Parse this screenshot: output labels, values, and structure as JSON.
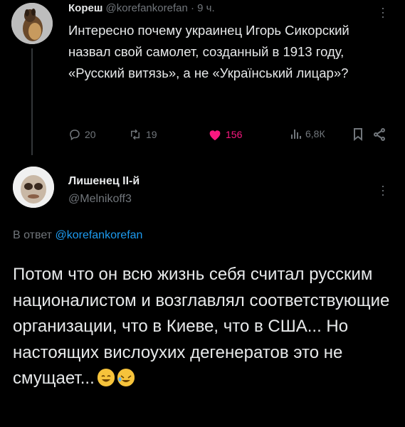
{
  "tweet": {
    "author_name": "Кореш",
    "author_handle": "@korefankorefan",
    "separator": "·",
    "time": "9 ч.",
    "text": "Интересно почему украинец Игорь Сикорский назвал свой самолет, созданный в 1913 году, «Русский витязь», а не «Український лицар»?",
    "stats": {
      "replies": "20",
      "retweets": "19",
      "likes": "156",
      "views": "6,8К"
    }
  },
  "reply": {
    "author_name": "Лишенец II-й",
    "author_handle": "@Melnikoff3",
    "reply_to_prefix": "В ответ",
    "reply_to_handle": "@korefankorefan",
    "text": "Потом что он всю жизнь себя считал русским националистом и возглавлял соответствующие организации, что в Киеве, что в США... Но настоящих вислоухих дегенератов это не смущает...",
    "emojis": [
      "smiling-face-icon",
      "rolling-laughing-icon"
    ]
  },
  "colors": {
    "background": "#000000",
    "text": "#e7e9ea",
    "muted": "#71767b",
    "link": "#1d9bf0",
    "like": "#f91880"
  }
}
